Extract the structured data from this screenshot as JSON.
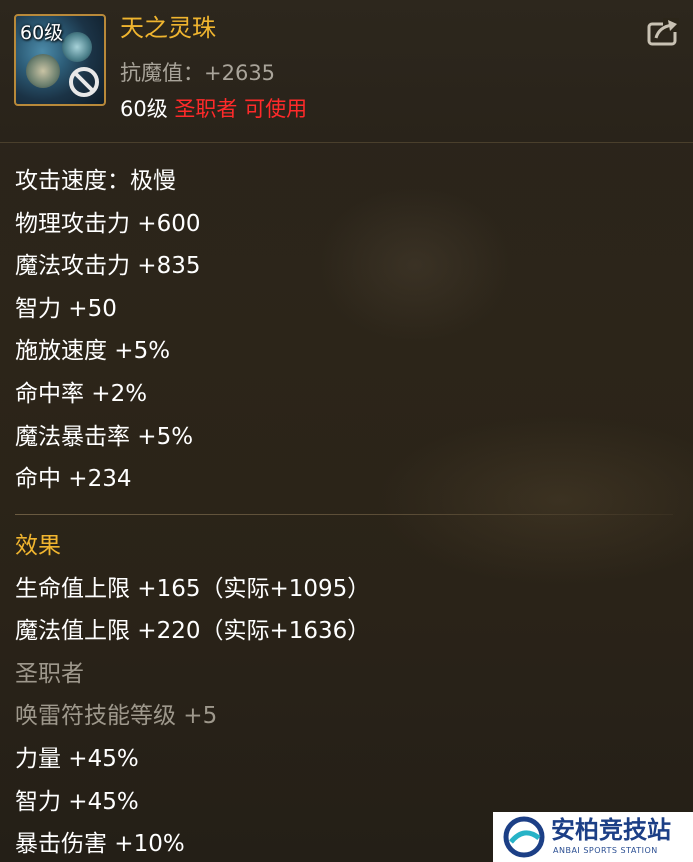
{
  "item": {
    "level_badge": "60级",
    "name": "天之灵珠",
    "resist_line": "抗魔值：+2635",
    "req_level": "60级",
    "req_class": "圣职者 可使用",
    "icon": "orb-item-icon",
    "share_icon": "share-icon"
  },
  "stats": [
    "攻击速度：极慢",
    "物理攻击力 +600",
    "魔法攻击力 +835",
    "智力 +50",
    "施放速度 +5%",
    "命中率 +2%",
    "魔法暴击率 +5%",
    "命中 +234"
  ],
  "effects": {
    "header": "效果",
    "lines": [
      "生命值上限 +165（实际+1095）",
      "魔法值上限 +220（实际+1636）",
      "圣职者",
      "唤雷符技能等级 +5",
      "力量 +45%",
      "智力 +45%",
      "暴击伤害 +10%"
    ]
  },
  "watermark": {
    "name": "安柏竞技站",
    "sub": "ANBAI SPORTS STATION"
  },
  "colors": {
    "gold": "#f0b52f",
    "red": "#ff2a2a",
    "grey": "#9e988c",
    "white": "#ffffff"
  }
}
